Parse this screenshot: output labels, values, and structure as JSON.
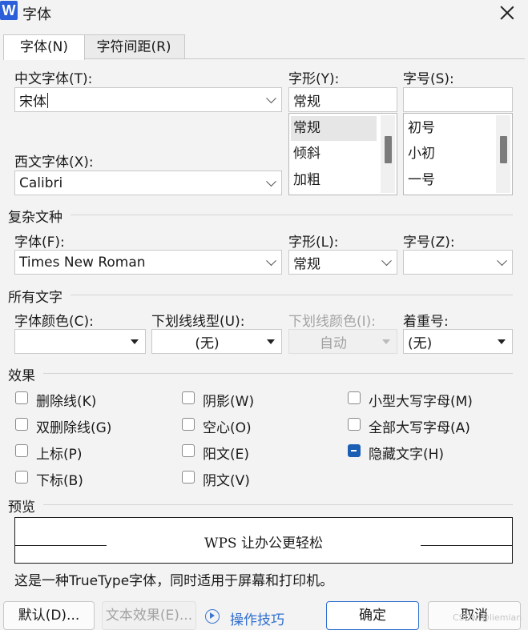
{
  "window": {
    "title": "字体",
    "app_icon_letter": "W"
  },
  "tabs": [
    {
      "label": "字体(N)"
    },
    {
      "label": "字符间距(R)"
    }
  ],
  "chinese_font": {
    "label": "中文字体(T):",
    "value": "宋体"
  },
  "western_font": {
    "label": "西文字体(X):",
    "value": "Calibri"
  },
  "style": {
    "label": "字形(Y):",
    "value": "常规",
    "options": [
      "常规",
      "倾斜",
      "加粗"
    ],
    "selected": "常规"
  },
  "size": {
    "label": "字号(S):",
    "value": "",
    "options": [
      "初号",
      "小初",
      "一号"
    ]
  },
  "complex": {
    "section_title": "复杂文种",
    "font_label": "字体(F):",
    "font_value": "Times New Roman",
    "style_label": "字形(L):",
    "style_value": "常规",
    "size_label": "字号(Z):",
    "size_value": ""
  },
  "all_text": {
    "section_title": "所有文字",
    "color_label": "字体颜色(C):",
    "color_value": "",
    "underline_label": "下划线线型(U):",
    "underline_value": "(无)",
    "underline_color_label": "下划线颜色(I):",
    "underline_color_value": "自动",
    "emphasis_label": "着重号:",
    "emphasis_value": "(无)"
  },
  "effects": {
    "section_title": "效果",
    "items": [
      {
        "label": "删除线(K)",
        "checked": false
      },
      {
        "label": "双删除线(G)",
        "checked": false
      },
      {
        "label": "上标(P)",
        "checked": false
      },
      {
        "label": "下标(B)",
        "checked": false
      },
      {
        "label": "阴影(W)",
        "checked": false
      },
      {
        "label": "空心(O)",
        "checked": false
      },
      {
        "label": "阳文(E)",
        "checked": false
      },
      {
        "label": "阴文(V)",
        "checked": false
      },
      {
        "label": "小型大写字母(M)",
        "checked": false
      },
      {
        "label": "全部大写字母(A)",
        "checked": false
      },
      {
        "label": "隐藏文字(H)",
        "checked": true
      }
    ]
  },
  "preview": {
    "section_title": "预览",
    "sample": "WPS 让办公更轻松",
    "note": "这是一种TrueType字体，同时适用于屏幕和打印机。"
  },
  "buttons": {
    "default": "默认(D)...",
    "text_effects": "文本效果(E)...",
    "tips": "操作技巧",
    "ok": "确定",
    "cancel": "取消"
  },
  "watermark": "CSDN @liemian",
  "colors": {
    "accent": "#2f6fcf",
    "checked": "#1a5fb4"
  }
}
